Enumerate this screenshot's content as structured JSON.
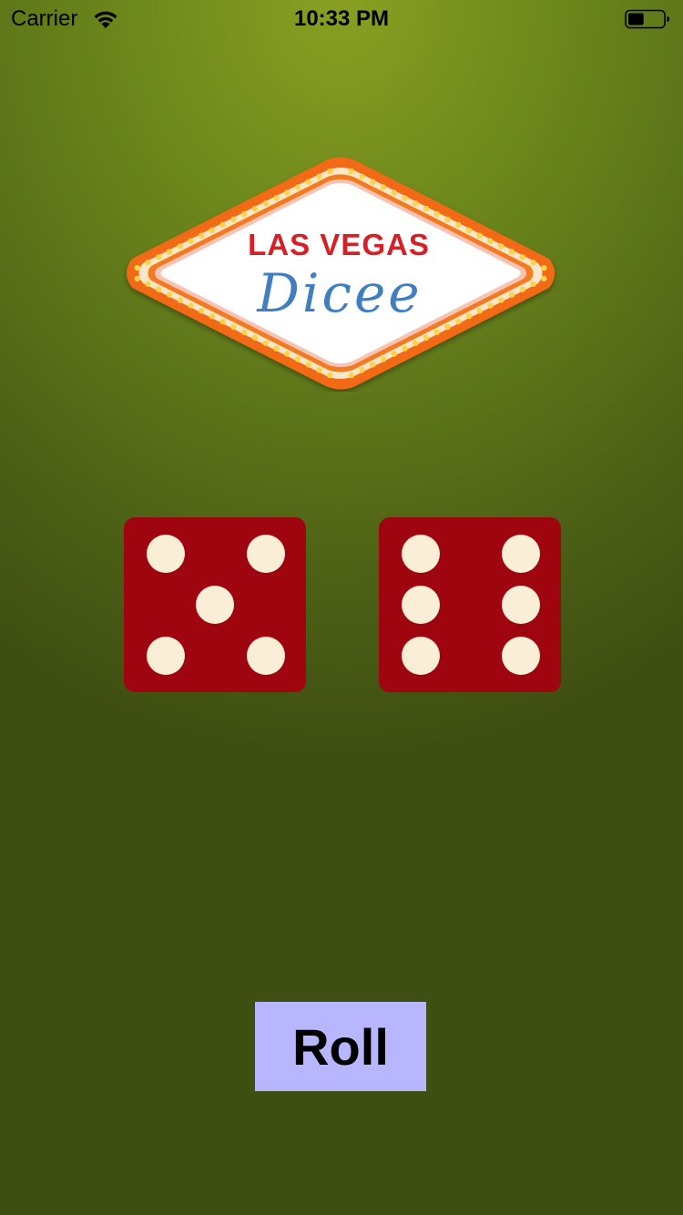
{
  "status_bar": {
    "carrier": "Carrier",
    "time": "10:33 PM",
    "wifi_icon": "wifi-icon",
    "battery_icon": "battery-icon",
    "battery_level": 0.45
  },
  "logo": {
    "line1": "LAS VEGAS",
    "line2": "Dicee"
  },
  "dice": {
    "left_value": 5,
    "right_value": 6,
    "color": "#9e050f",
    "pip_color": "#faeed6"
  },
  "roll_button": {
    "label": "Roll",
    "color": "#b8b6ff"
  },
  "colors": {
    "background_top": "#8a9f22",
    "background_bottom": "#3f4f12",
    "logo_red": "#d81f26",
    "logo_blue": "#3f7ec0",
    "logo_orange": "#f26a12",
    "logo_bulb": "#fcd34a"
  }
}
